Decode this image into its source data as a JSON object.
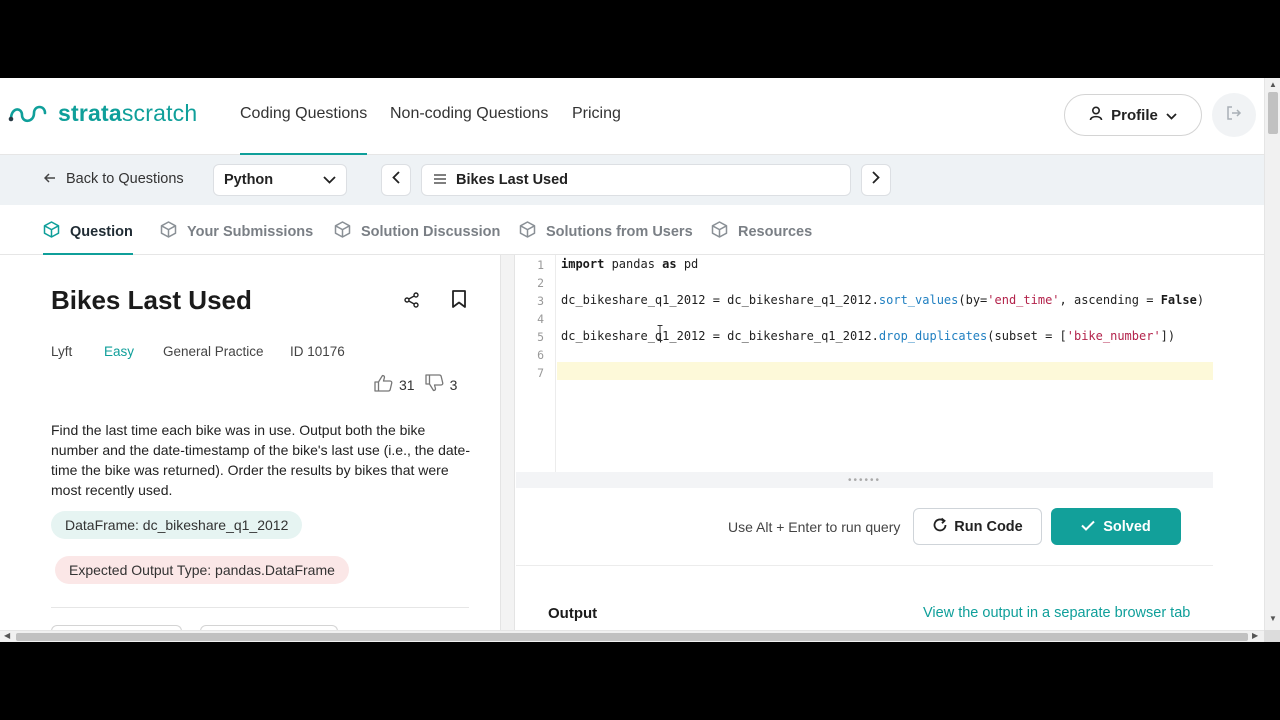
{
  "brand": {
    "name_part1": "strata",
    "name_part2": "scratch",
    "color": "#0f9f9a"
  },
  "topnav": {
    "links": [
      {
        "label": "Coding Questions",
        "active": true
      },
      {
        "label": "Non-coding Questions",
        "active": false
      },
      {
        "label": "Pricing",
        "active": false
      }
    ],
    "profile_label": "Profile"
  },
  "subbar": {
    "back_label": "Back to Questions",
    "language": "Python",
    "question_title": "Bikes Last Used"
  },
  "tabs": [
    {
      "label": "Question",
      "active": true
    },
    {
      "label": "Your Submissions",
      "active": false
    },
    {
      "label": "Solution Discussion",
      "active": false
    },
    {
      "label": "Solutions from Users",
      "active": false
    },
    {
      "label": "Resources",
      "active": false
    }
  ],
  "question": {
    "title": "Bikes Last Used",
    "company": "Lyft",
    "difficulty": "Easy",
    "category": "General Practice",
    "id": "ID 10176",
    "upvotes": "31",
    "downvotes": "3",
    "description": "Find the last time each bike was in use. Output both the bike number and the date-timestamp of the bike's last use (i.e., the date-time the bike was returned). Order the results by bikes that were most recently used.",
    "dataframe": "DataFrame: dc_bikeshare_q1_2012",
    "expected_output": "Expected Output Type: pandas.DataFrame"
  },
  "editor": {
    "line_numbers": [
      "1",
      "2",
      "3",
      "4",
      "5",
      "6",
      "7"
    ],
    "lines": [
      "import pandas as pd",
      "",
      "dc_bikeshare_q1_2012 = dc_bikeshare_q1_2012.sort_values(by='end_time', ascending = False)",
      "",
      "dc_bikeshare_q1_2012 = dc_bikeshare_q1_2012.drop_duplicates(subset = ['bike_number'])",
      "",
      ""
    ]
  },
  "run": {
    "hint": "Use Alt + Enter to run query",
    "run_label": "Run Code",
    "solved_label": "Solved"
  },
  "output": {
    "title": "Output",
    "link": "View the output in a separate browser tab"
  }
}
